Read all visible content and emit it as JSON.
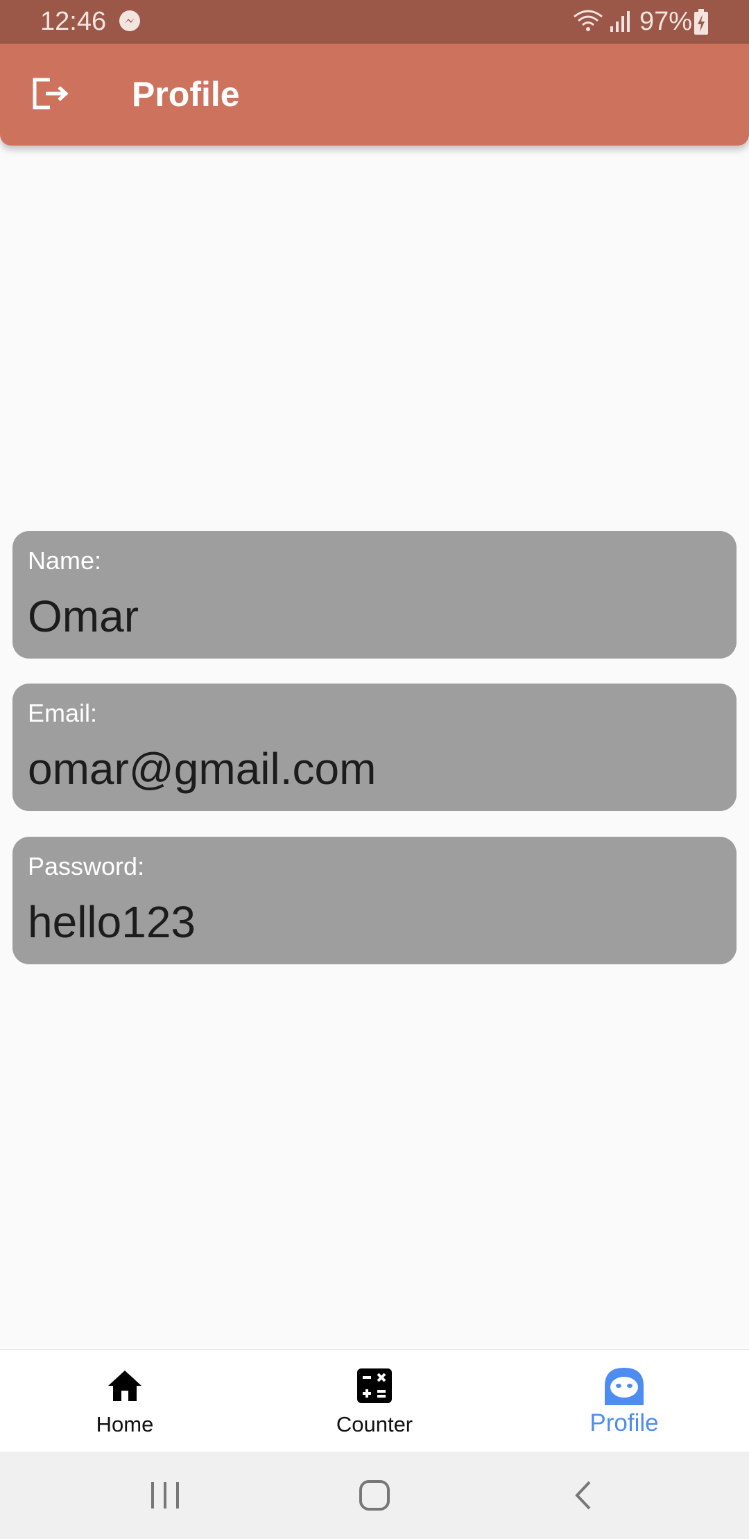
{
  "status_bar": {
    "time": "12:46",
    "battery": "97%"
  },
  "app_bar": {
    "title": "Profile",
    "leading_icon": "logout-icon",
    "color": "#cd725c"
  },
  "fields": [
    {
      "label": "Name:",
      "value": "Omar"
    },
    {
      "label": "Email:",
      "value": "omar@gmail.com"
    },
    {
      "label": "Password:",
      "value": "hello123"
    }
  ],
  "bottom_nav": {
    "items": [
      {
        "label": "Home",
        "icon": "home-icon"
      },
      {
        "label": "Counter",
        "icon": "calculator-icon"
      },
      {
        "label": "Profile",
        "icon": "face-icon",
        "active": true
      }
    ],
    "active_color": "#4d8cf0"
  },
  "system_nav": {
    "icons": [
      "recent-apps-icon",
      "home-circle-icon",
      "back-icon"
    ]
  }
}
